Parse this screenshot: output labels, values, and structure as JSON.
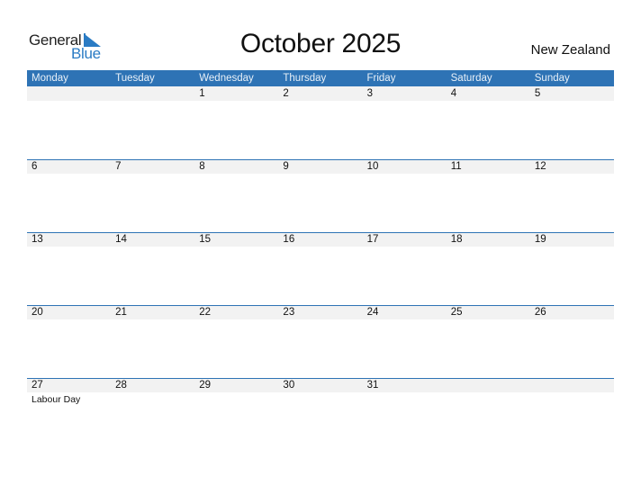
{
  "brand": {
    "name_top": "General",
    "name_bottom": "Blue",
    "accent": "#2a7bc4"
  },
  "title": "October 2025",
  "country": "New Zealand",
  "colors": {
    "header_bg": "#2e73b5",
    "row_strip": "#f2f2f2"
  },
  "weekdays": [
    "Monday",
    "Tuesday",
    "Wednesday",
    "Thursday",
    "Friday",
    "Saturday",
    "Sunday"
  ],
  "weeks": [
    {
      "days": [
        {
          "num": ""
        },
        {
          "num": ""
        },
        {
          "num": "1"
        },
        {
          "num": "2"
        },
        {
          "num": "3"
        },
        {
          "num": "4"
        },
        {
          "num": "5"
        }
      ]
    },
    {
      "days": [
        {
          "num": "6"
        },
        {
          "num": "7"
        },
        {
          "num": "8"
        },
        {
          "num": "9"
        },
        {
          "num": "10"
        },
        {
          "num": "11"
        },
        {
          "num": "12"
        }
      ]
    },
    {
      "days": [
        {
          "num": "13"
        },
        {
          "num": "14"
        },
        {
          "num": "15"
        },
        {
          "num": "16"
        },
        {
          "num": "17"
        },
        {
          "num": "18"
        },
        {
          "num": "19"
        }
      ]
    },
    {
      "days": [
        {
          "num": "20"
        },
        {
          "num": "21"
        },
        {
          "num": "22"
        },
        {
          "num": "23"
        },
        {
          "num": "24"
        },
        {
          "num": "25"
        },
        {
          "num": "26"
        }
      ]
    },
    {
      "days": [
        {
          "num": "27",
          "event": "Labour Day"
        },
        {
          "num": "28"
        },
        {
          "num": "29"
        },
        {
          "num": "30"
        },
        {
          "num": "31"
        },
        {
          "num": ""
        },
        {
          "num": ""
        }
      ]
    }
  ]
}
